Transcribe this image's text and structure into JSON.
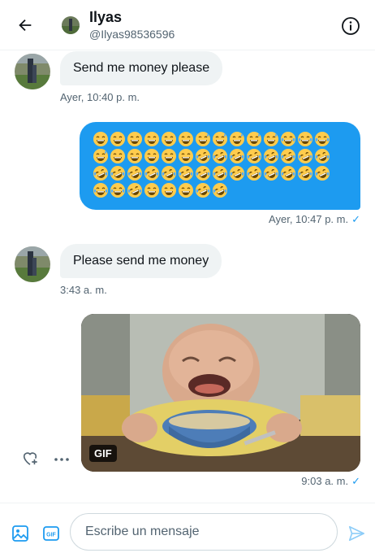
{
  "header": {
    "name": "Ilyas",
    "handle": "@Ilyas98536596",
    "back_icon": "back-arrow-icon",
    "info_icon": "info-icon"
  },
  "messages": [
    {
      "direction": "incoming",
      "text": "Send me money please",
      "timestamp": "Ayer, 10:40 p. m."
    },
    {
      "direction": "outgoing",
      "type": "emoji",
      "emoji_rows": [
        [
          "😄",
          "😄",
          "😄",
          "😄",
          "😄",
          "😄",
          "😅",
          "😅",
          "😅",
          "😅",
          "😅",
          "😂",
          "😂",
          "😂"
        ],
        [
          "😅",
          "😄",
          "😄",
          "😄",
          "😄",
          "😄",
          "🤣",
          "🤣",
          "🤣",
          "🤣",
          "🤣",
          "🤣",
          "🤣",
          "🤣"
        ],
        [
          "🤣",
          "🤣",
          "🤣",
          "🤣",
          "🤣",
          "🤣",
          "🤣",
          "🤣",
          "🤣",
          "🤣",
          "🤣",
          "🤣",
          "🤣",
          "🤣"
        ],
        [
          "😂",
          "😂",
          "🤣",
          "😄",
          "😄",
          "😄",
          "🤣",
          "🤣"
        ]
      ],
      "timestamp": "Ayer, 10:47 p. m.",
      "read_check": "✓"
    },
    {
      "direction": "incoming",
      "text": "Please send me money",
      "timestamp": "3:43 a. m."
    },
    {
      "direction": "outgoing",
      "type": "gif",
      "badge": "GIF",
      "timestamp": "9:03 a. m.",
      "read_check": "✓"
    }
  ],
  "actions": {
    "react_icon": "heart-plus-icon",
    "more_icon": "more-horizontal-icon"
  },
  "composer": {
    "placeholder": "Escribe un mensaje",
    "media_icon": "image-icon",
    "gif_icon": "gif-icon",
    "send_icon": "send-icon"
  },
  "colors": {
    "accent": "#1d9bf0",
    "incoming_bubble": "#eff3f4",
    "secondary_text": "#536471"
  }
}
